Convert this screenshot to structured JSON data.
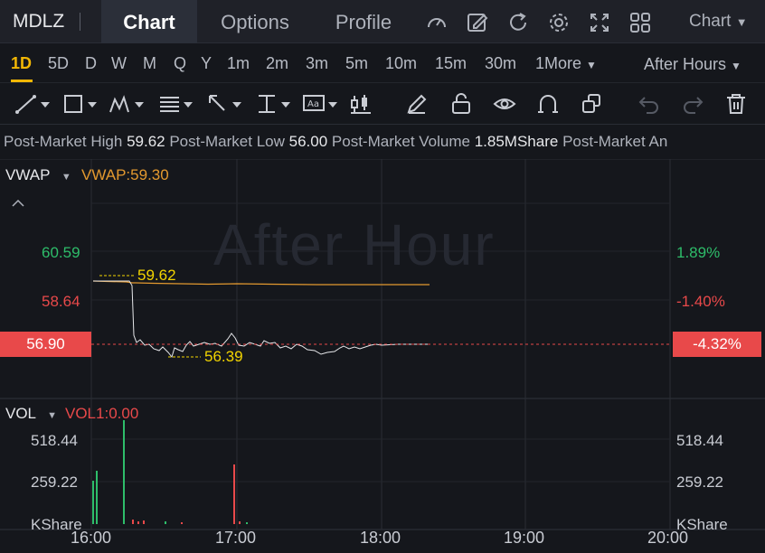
{
  "header": {
    "symbol": "MDLZ",
    "tabs": [
      {
        "label": "Chart",
        "active": true
      },
      {
        "label": "Options",
        "active": false
      },
      {
        "label": "Profile",
        "active": false
      }
    ],
    "chart_dropdown": "Chart",
    "icons": [
      "gauge-icon",
      "edit-icon",
      "refresh-icon",
      "settings-icon",
      "fullscreen-icon",
      "grid-layout-icon"
    ]
  },
  "periods": {
    "items": [
      "1D",
      "5D",
      "D",
      "W",
      "M",
      "Q",
      "Y",
      "1m",
      "2m",
      "3m",
      "5m",
      "10m",
      "15m",
      "30m"
    ],
    "active": "1D",
    "more": "1More",
    "session": "After Hours"
  },
  "info": {
    "high_label": "Post-Market High",
    "high_value": "59.62",
    "low_label": "Post-Market Low",
    "low_value": "56.00",
    "vol_label": "Post-Market Volume",
    "vol_value": "1.85MShare",
    "amt_label": "Post-Market An"
  },
  "price_panel": {
    "indicator": "VWAP",
    "indicator_value": "VWAP:59.30",
    "watermark": "After Hour",
    "left_axis": [
      "60.59",
      "58.64"
    ],
    "right_axis": [
      "1.89%",
      "-1.40%"
    ],
    "current_price": "56.90",
    "current_pct": "-4.32%",
    "high_marker": "59.62",
    "low_marker": "56.39"
  },
  "volume_panel": {
    "indicator": "VOL",
    "indicator_value": "VOL1:0.00",
    "left_axis": [
      "518.44",
      "259.22",
      "KShare"
    ],
    "right_axis": [
      "518.44",
      "259.22",
      "KShare"
    ]
  },
  "x_axis": [
    "16:00",
    "17:00",
    "18:00",
    "19:00",
    "20:00"
  ],
  "colors": {
    "up": "#2ebd6a",
    "down": "#e8494a",
    "accent": "#f2b705",
    "vwap_line": "#e3992f"
  }
}
